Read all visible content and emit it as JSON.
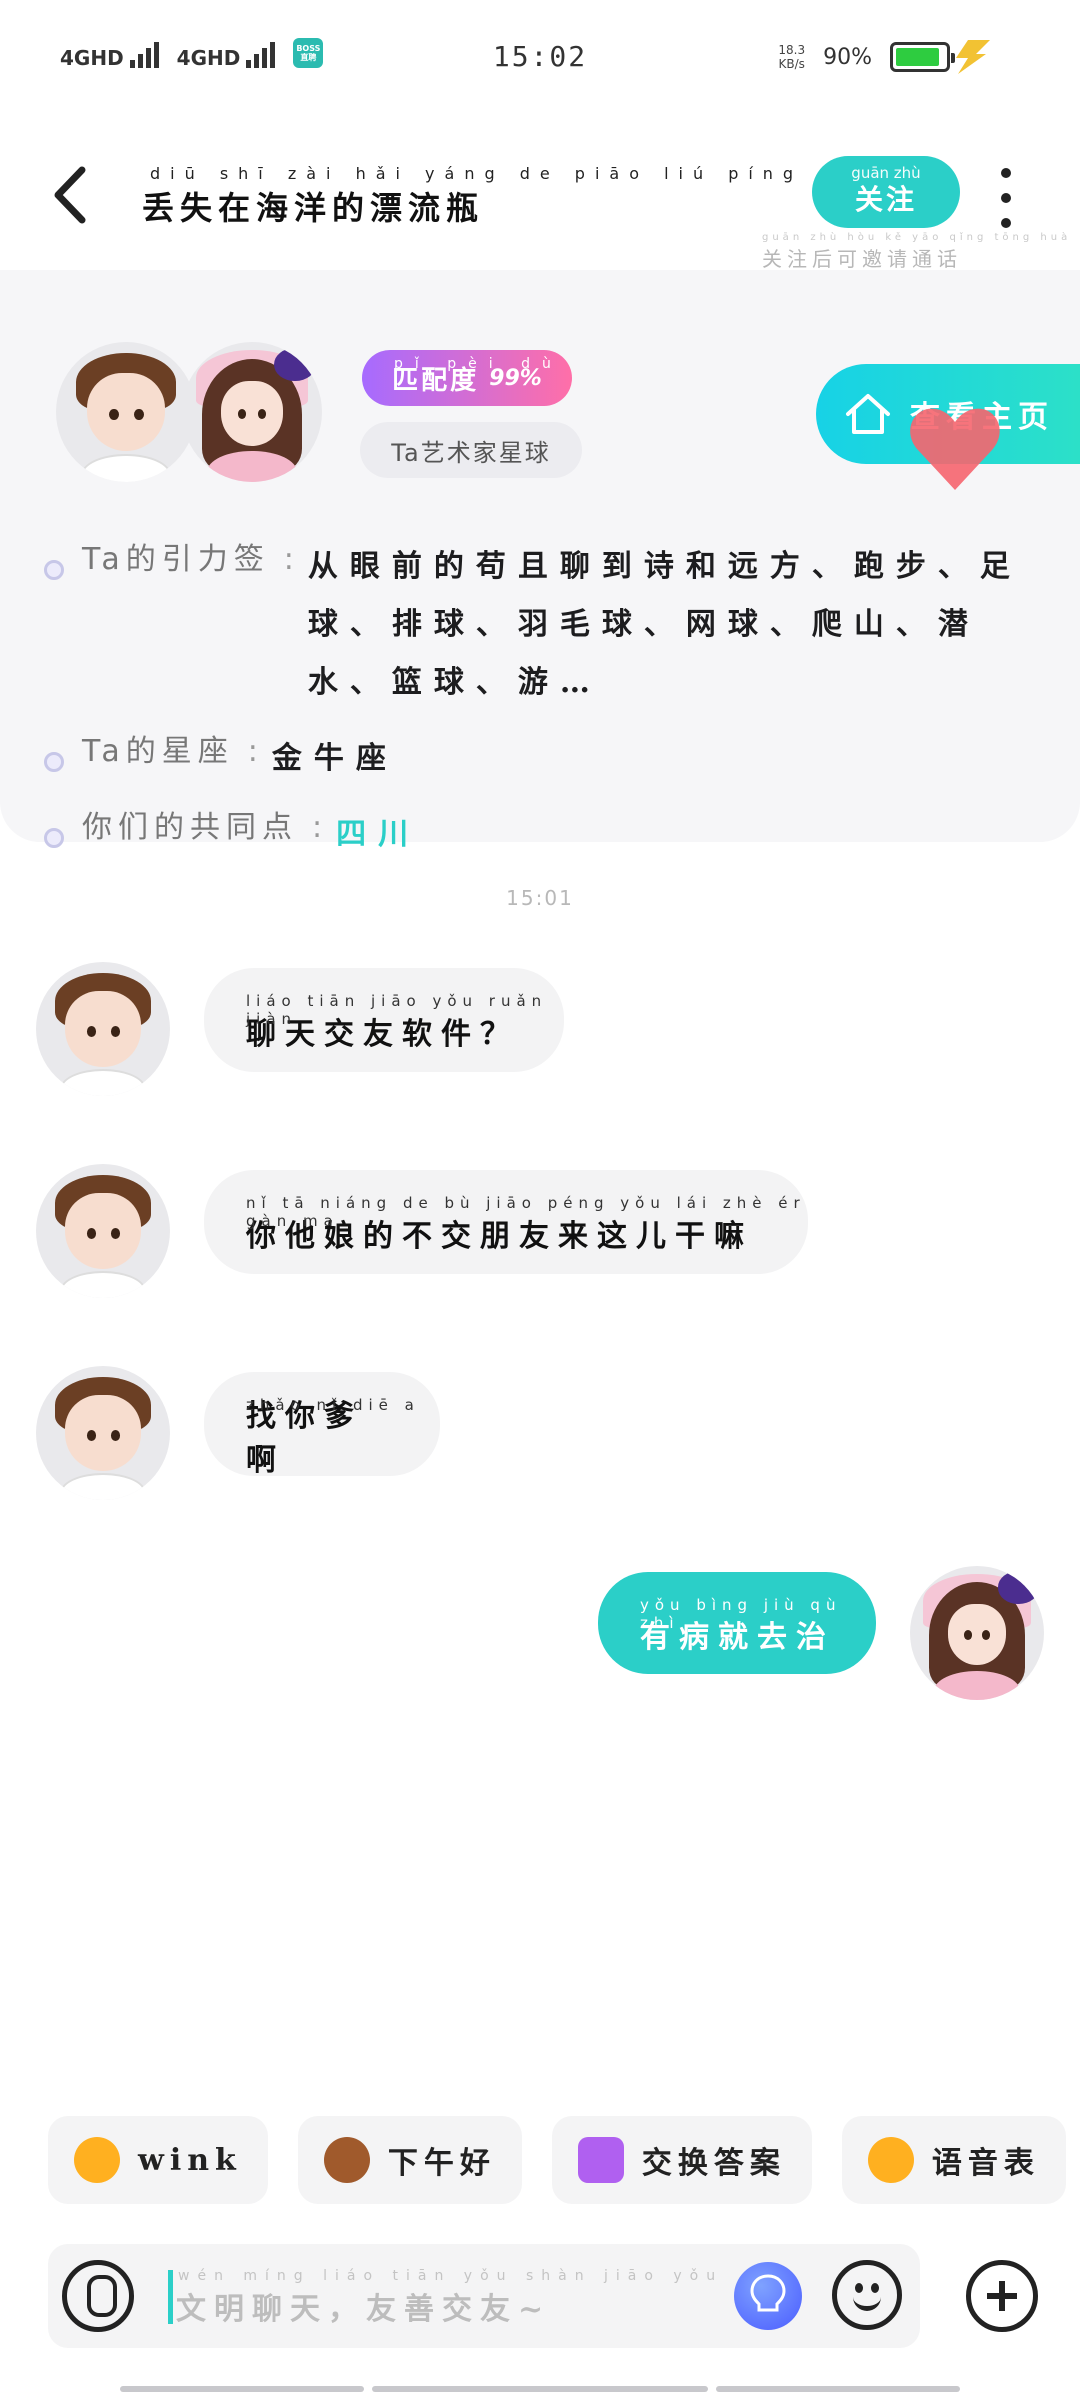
{
  "status_bar": {
    "network1": "4GHD",
    "network2": "4GHD",
    "boss_app": "BOSS直聘",
    "time": "15:02",
    "speed_value": "18.3",
    "speed_unit": "KB/s",
    "battery_percent": "90%",
    "battery_level": 0.9
  },
  "header": {
    "title_pinyin": "diū shī zài hǎi yáng de piāo liú píng",
    "title": "丢失在海洋的漂流瓶",
    "follow_pinyin": "guān zhù",
    "follow_label": "关注",
    "follow_hint_pinyin": "guān zhù hòu kě yāo qǐng tōng huà",
    "follow_hint": "关注后可邀请通话"
  },
  "profile": {
    "match_pinyin": "pǐ pèi dù",
    "match_label": "匹配度",
    "match_value": "99%",
    "star_label": "Ta艺术家星球",
    "home_button_label": "查看主页",
    "rows": [
      {
        "label": "Ta的引力签",
        "value": "从眼前的苟且聊到诗和远方、跑步、足球、排球、羽毛球、网球、爬山、潜水、篮球、游…"
      },
      {
        "label": "Ta的星座",
        "value": "金牛座"
      },
      {
        "label": "你们的共同点",
        "value": "四川"
      }
    ]
  },
  "chat": {
    "time": "15:01",
    "messages": [
      {
        "from": "them",
        "pinyin": "liáo tiān jiāo yǒu ruǎn jiàn",
        "text": "聊天交友软件？"
      },
      {
        "from": "them",
        "pinyin": "nǐ tā niáng de bù jiāo péng yǒu lái zhè ér gàn ma",
        "text": "你他娘的不交朋友来这儿干嘛"
      },
      {
        "from": "them",
        "pinyin": "zhǎo nǐ diē a",
        "text": "找你爹啊"
      },
      {
        "from": "me",
        "pinyin": "yǒu bìng jiù qù zhì",
        "text": "有病就去治"
      }
    ]
  },
  "quick_replies": [
    {
      "label": "wink",
      "icon": "wink-emoji-icon",
      "color": "#ffb020"
    },
    {
      "label": "下午好",
      "icon": "coffee-icon",
      "color": "#a05a2c"
    },
    {
      "label": "交换答案",
      "icon": "exchange-icon",
      "color": "#b060f0"
    },
    {
      "label": "语音表",
      "icon": "voice-emoji-icon",
      "color": "#ffb020"
    }
  ],
  "input": {
    "placeholder_pinyin": "wén míng liáo tiān  yǒu shàn jiāo yǒu",
    "placeholder": "文明聊天，友善交友~"
  },
  "colors": {
    "accent": "#2bcfc8",
    "bubble_other": "#f3f3f4",
    "match_gradient_start": "#a66bff",
    "match_gradient_end": "#ff6fa8"
  }
}
